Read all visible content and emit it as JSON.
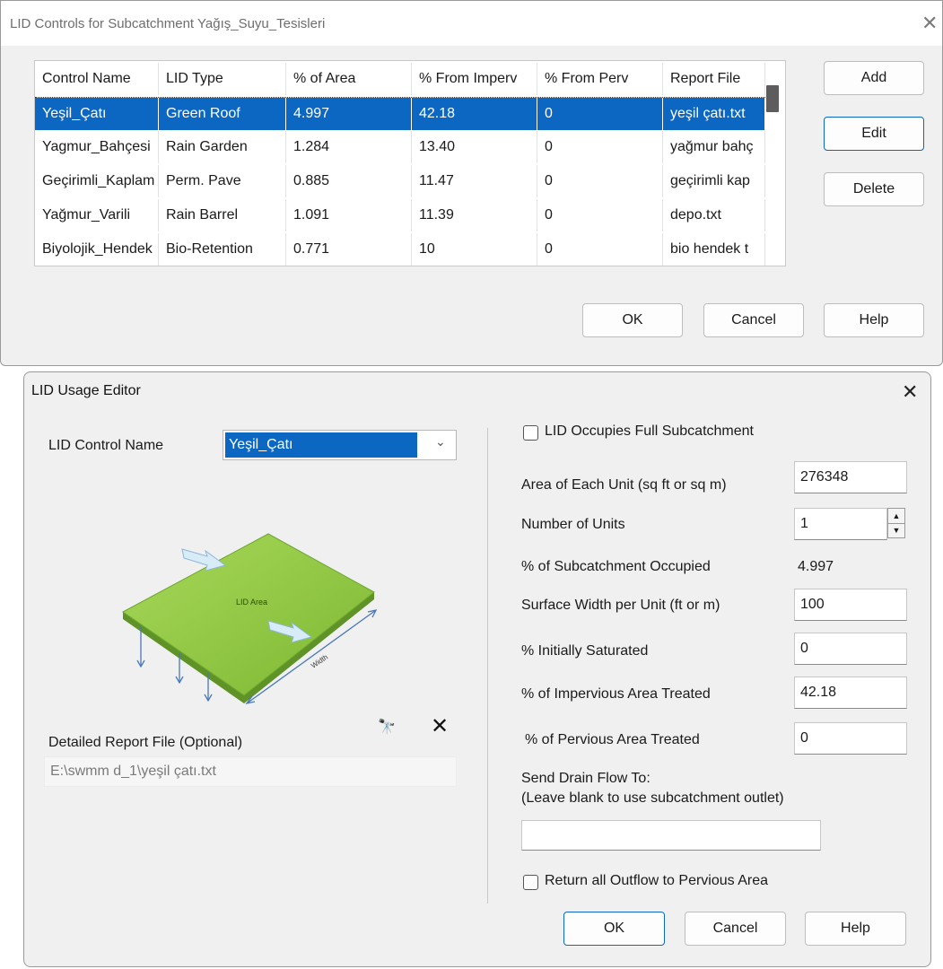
{
  "controls_window": {
    "title": "LID Controls for Subcatchment Yağış_Suyu_Tesisleri",
    "columns": [
      "Control Name",
      "LID Type",
      "% of Area",
      "% From Imperv",
      "% From Perv",
      "Report File"
    ],
    "rows": [
      [
        "Yeşil_Çatı",
        "Green Roof",
        "4.997",
        "42.18",
        "0",
        "yeşil çatı.txt"
      ],
      [
        "Yagmur_Bahçesi",
        "Rain Garden",
        "1.284",
        "13.40",
        "0",
        "yağmur bahç"
      ],
      [
        "Geçirimli_Kaplam",
        "Perm. Pave",
        "0.885",
        "11.47",
        "0",
        "geçirimli kap"
      ],
      [
        "Yağmur_Varili",
        "Rain Barrel",
        "1.091",
        "11.39",
        "0",
        "depo.txt"
      ],
      [
        "Biyolojik_Hendek",
        "Bio-Retention",
        "0.771",
        "10",
        "0",
        "bio hendek t"
      ]
    ],
    "selected_row": 0,
    "buttons": {
      "add": "Add",
      "edit": "Edit",
      "delete": "Delete",
      "ok": "OK",
      "cancel": "Cancel",
      "help": "Help"
    }
  },
  "usage_editor": {
    "title": "LID Usage Editor",
    "lid_control_name_label": "LID Control Name",
    "lid_control_name_value": "Yeşil_Çatı",
    "illustration": {
      "area_label": "LID Area",
      "width_label": "Width"
    },
    "report_file_label": "Detailed Report File (Optional)",
    "report_file_value": "E:\\swmm d_1\\yeşil çatı.txt",
    "occupies_full_label": "LID Occupies Full Subcatchment",
    "area_each_unit_label": "Area of Each Unit (sq ft or sq m)",
    "area_each_unit_value": "276348",
    "number_units_label": "Number of Units",
    "number_units_value": "1",
    "pct_occupied_label": "% of Subcatchment Occupied",
    "pct_occupied_value": "4.997",
    "surface_width_label": "Surface Width per Unit (ft or m)",
    "surface_width_value": "100",
    "initially_saturated_label": "% Initially Saturated",
    "initially_saturated_value": "0",
    "impervious_treated_label": "% of Impervious Area Treated",
    "impervious_treated_value": "42.18",
    "pervious_treated_label": "% of Pervious Area Treated",
    "pervious_treated_value": "0",
    "send_drain_label": "Send Drain Flow To:",
    "send_drain_hint": "(Leave blank to use subcatchment outlet)",
    "send_drain_value": "",
    "return_outflow_label": "Return all Outflow to Pervious Area",
    "buttons": {
      "ok": "OK",
      "cancel": "Cancel",
      "help": "Help"
    }
  },
  "colors": {
    "selection": "#0b67c2",
    "green_roof": "#8cc63f",
    "window_bg": "#f0f0f0"
  }
}
